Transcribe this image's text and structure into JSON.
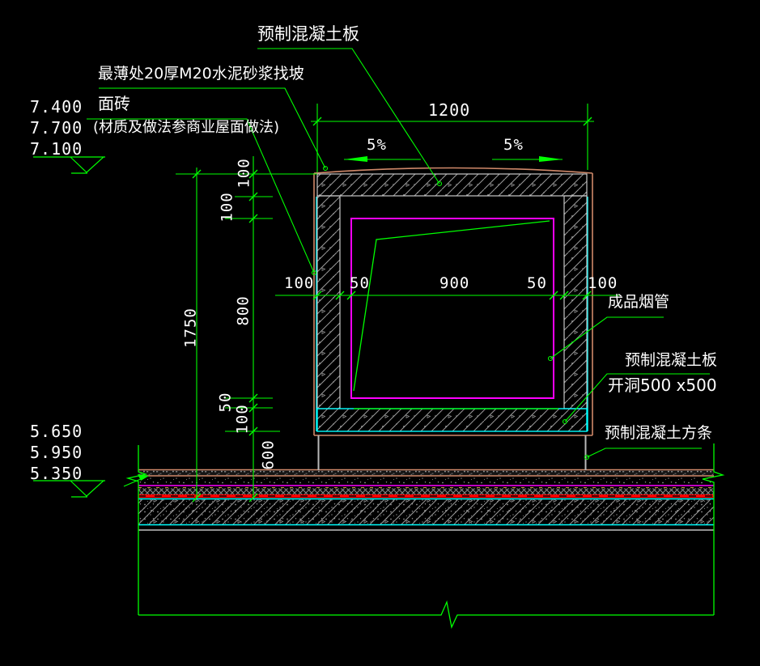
{
  "labels": {
    "precast_slab_top": "预制混凝土板",
    "mortar": "最薄处20厚M20水泥砂浆找坡",
    "tile": "面砖",
    "tile_note": "(材质及做法参商业屋面做法)",
    "flue": "成品烟管",
    "precast_slab_right": "预制混凝土板",
    "opening": "开洞500 x500",
    "strip": "预制混凝土方条"
  },
  "elevations": {
    "upper": [
      "7.400",
      "7.700",
      "7.100"
    ],
    "lower": [
      "5.650",
      "5.950",
      "5.350"
    ]
  },
  "dimensions": {
    "width_top": "1200",
    "slope_left": "5%",
    "slope_right": "5%",
    "h_chain": [
      "100",
      "50",
      "900",
      "50",
      "100"
    ],
    "v_chain": [
      "100",
      "100",
      "800",
      "50",
      "100",
      "600"
    ],
    "height_overall": "1750"
  },
  "colors": {
    "dimension_line": "#00ff00",
    "text": "#ffffff",
    "flue_pipe": "#ff00ff",
    "lining": "#00ffff",
    "waterproof_membrane": "#ff0000",
    "finish_layer": "#d0896a"
  }
}
